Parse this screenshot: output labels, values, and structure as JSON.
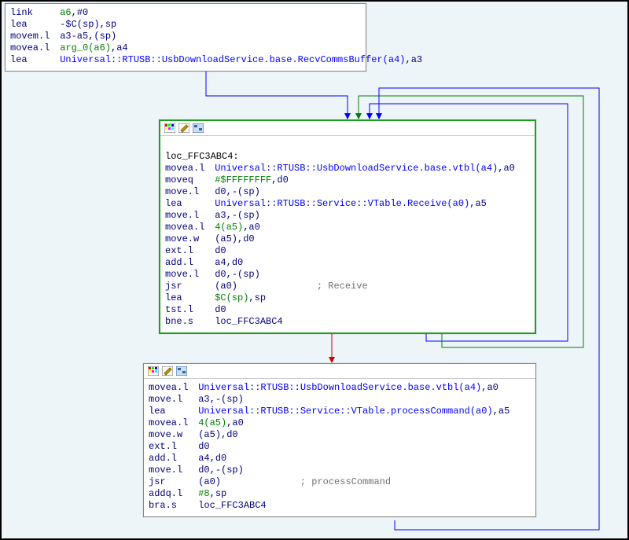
{
  "node1": {
    "lines": [
      {
        "m": "link",
        "o1": "a6",
        "o2": "#0",
        "lit": true
      },
      {
        "m": "lea",
        "o1": "-$C(sp)",
        "o2": "sp"
      },
      {
        "m": "movem.l",
        "o1": "a3-a5",
        "o2": "(sp)"
      },
      {
        "m": "movea.l",
        "o1": "arg_0(a6)",
        "o2": "a4",
        "o1lit": true
      },
      {
        "m": "lea",
        "sym": "Universal::RTUSB::UsbDownloadService.base.RecvCommsBuffer(a4)",
        "o2": "a3"
      }
    ]
  },
  "node2": {
    "label": "loc_FFC3ABC4:",
    "lines": [
      {
        "m": "movea.l",
        "sym": "Universal::RTUSB::UsbDownloadService.base.vtbl(a4)",
        "o2": "a0"
      },
      {
        "m": "moveq",
        "o1": "#$FFFFFFFF",
        "o2": "d0",
        "o1lit": true
      },
      {
        "m": "move.l",
        "o1": "d0",
        "o2": "-(sp)"
      },
      {
        "m": "lea",
        "sym": "Universal::RTUSB::Service::VTable.Receive(a0)",
        "o2": "a5"
      },
      {
        "m": "move.l",
        "o1": "a3",
        "o2": "-(sp)"
      },
      {
        "m": "movea.l",
        "o1": "4(a5)",
        "o2": "a0",
        "o1lit": true
      },
      {
        "m": "move.w",
        "o1": "(a5)",
        "o2": "d0"
      },
      {
        "m": "ext.l",
        "o1": "d0"
      },
      {
        "m": "add.l",
        "o1": "a4",
        "o2": "d0"
      },
      {
        "m": "move.l",
        "o1": "d0",
        "o2": "-(sp)"
      },
      {
        "m": "jsr",
        "o1": "(a0)",
        "c": "; Receive"
      },
      {
        "m": "lea",
        "o1": "$C(sp)",
        "o2": "sp",
        "o1lit": true
      },
      {
        "m": "tst.l",
        "o1": "d0"
      },
      {
        "m": "bne.s",
        "o1": "loc_FFC3ABC4"
      }
    ]
  },
  "node3": {
    "lines": [
      {
        "m": "movea.l",
        "sym": "Universal::RTUSB::UsbDownloadService.base.vtbl(a4)",
        "o2": "a0"
      },
      {
        "m": "move.l",
        "o1": "a3",
        "o2": "-(sp)"
      },
      {
        "m": "lea",
        "sym": "Universal::RTUSB::Service::VTable.processCommand(a0)",
        "o2": "a5"
      },
      {
        "m": "movea.l",
        "o1": "4(a5)",
        "o2": "a0",
        "o1lit": true
      },
      {
        "m": "move.w",
        "o1": "(a5)",
        "o2": "d0"
      },
      {
        "m": "ext.l",
        "o1": "d0"
      },
      {
        "m": "add.l",
        "o1": "a4",
        "o2": "d0"
      },
      {
        "m": "move.l",
        "o1": "d0",
        "o2": "-(sp)"
      },
      {
        "m": "jsr",
        "o1": "(a0)",
        "c": "; processCommand"
      },
      {
        "m": "addq.l",
        "o1": "#8",
        "o2": "sp",
        "o1lit": true
      },
      {
        "m": "bra.s",
        "o1": "loc_FFC3ABC4"
      }
    ]
  },
  "icons": {
    "palette": "palette-icon",
    "edit": "edit-icon",
    "group": "group-icon"
  }
}
